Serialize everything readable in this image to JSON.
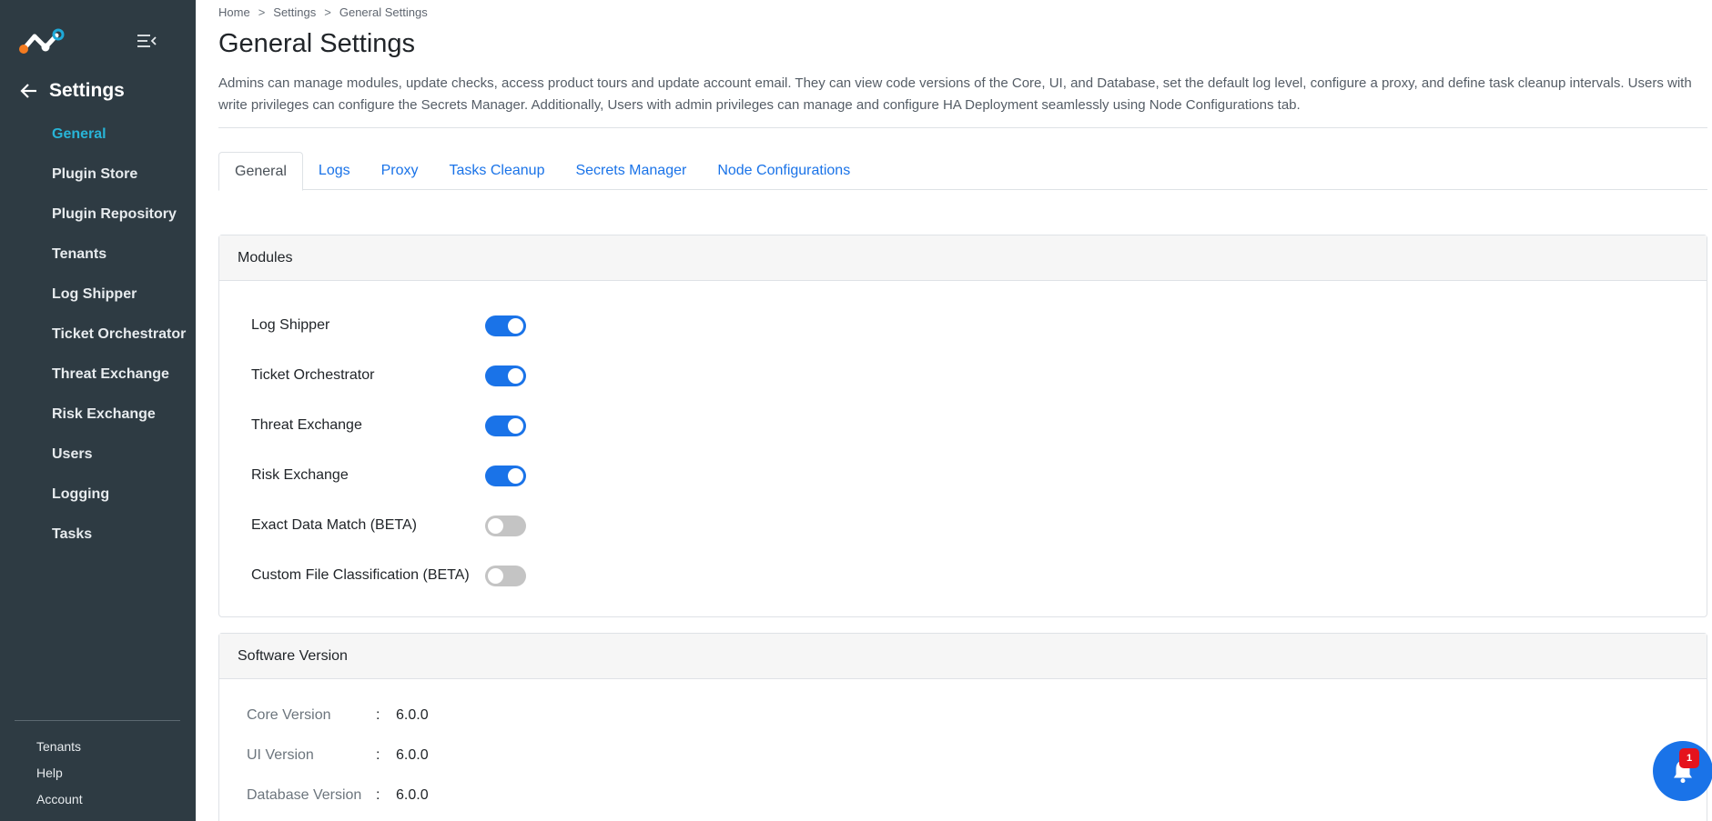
{
  "sidebar": {
    "header": {
      "title": "Settings"
    },
    "items": [
      {
        "label": "General",
        "active": true
      },
      {
        "label": "Plugin Store"
      },
      {
        "label": "Plugin Repository"
      },
      {
        "label": "Tenants"
      },
      {
        "label": "Log Shipper"
      },
      {
        "label": "Ticket Orchestrator"
      },
      {
        "label": "Threat Exchange"
      },
      {
        "label": "Risk Exchange"
      },
      {
        "label": "Users"
      },
      {
        "label": "Logging"
      },
      {
        "label": "Tasks"
      }
    ],
    "bottom": [
      {
        "label": "Tenants"
      },
      {
        "label": "Help"
      },
      {
        "label": "Account"
      }
    ]
  },
  "breadcrumb": {
    "home": "Home",
    "sep": ">",
    "settings": "Settings",
    "current": "General Settings"
  },
  "page": {
    "title": "General Settings",
    "description": "Admins can manage modules, update checks, access product tours and update account email. They can view code versions of the Core, UI, and Database, set the default log level, configure a proxy, and define task cleanup intervals. Users with write privileges can configure the Secrets Manager. Additionally, Users with admin privileges can manage and configure HA Deployment seamlessly using Node Configurations tab."
  },
  "tabs": [
    {
      "label": "General",
      "active": true
    },
    {
      "label": "Logs"
    },
    {
      "label": "Proxy"
    },
    {
      "label": "Tasks Cleanup"
    },
    {
      "label": "Secrets Manager"
    },
    {
      "label": "Node Configurations"
    }
  ],
  "modules": {
    "title": "Modules",
    "items": [
      {
        "label": "Log Shipper",
        "enabled": true
      },
      {
        "label": "Ticket Orchestrator",
        "enabled": true
      },
      {
        "label": "Threat Exchange",
        "enabled": true
      },
      {
        "label": "Risk Exchange",
        "enabled": true
      },
      {
        "label": "Exact Data Match (BETA)",
        "enabled": false
      },
      {
        "label": "Custom File Classification (BETA)",
        "enabled": false
      }
    ]
  },
  "software_version": {
    "title": "Software Version",
    "separator": ":",
    "rows": [
      {
        "label": "Core Version",
        "value": "6.0.0"
      },
      {
        "label": "UI Version",
        "value": "6.0.0"
      },
      {
        "label": "Database Version",
        "value": "6.0.0"
      }
    ]
  },
  "notifications": {
    "count": "1"
  },
  "colors": {
    "sidebar_bg": "#2e3b43",
    "active_nav": "#28b4d7",
    "accent": "#1a73e8",
    "toggle_off": "#c4c4c4",
    "badge": "#e5131d",
    "logo_orange": "#f47b20",
    "logo_teal": "#1ea9d8"
  }
}
